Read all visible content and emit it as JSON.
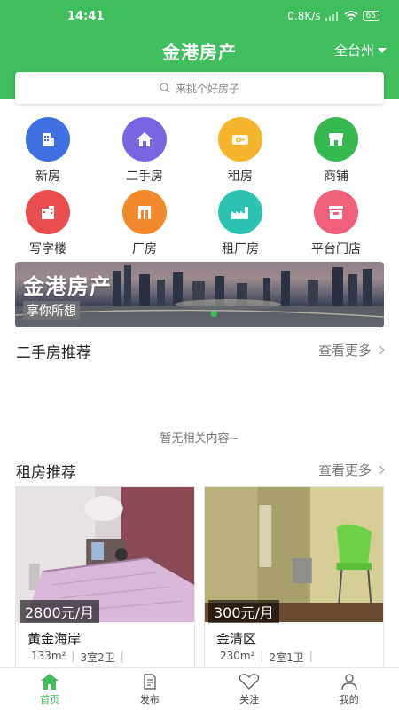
{
  "statusbar": {
    "time": "14:41",
    "network": "0.8K/s",
    "battery": "65"
  },
  "header": {
    "title": "金港房产",
    "city": "全台州"
  },
  "search": {
    "placeholder": "来挑个好房子"
  },
  "categories": [
    {
      "label": "新房",
      "icon": "building-icon",
      "color": "#3f6fe0"
    },
    {
      "label": "二手房",
      "icon": "house-icon",
      "color": "#7766e0"
    },
    {
      "label": "租房",
      "icon": "key-icon",
      "color": "#f5b52c"
    },
    {
      "label": "商铺",
      "icon": "shop-icon",
      "color": "#36b84f"
    },
    {
      "label": "写字楼",
      "icon": "office-icon",
      "color": "#ea4d4d"
    },
    {
      "label": "厂房",
      "icon": "factory-door-icon",
      "color": "#f08a2c"
    },
    {
      "label": "租厂房",
      "icon": "factory-icon",
      "color": "#2cc4b0"
    },
    {
      "label": "平台门店",
      "icon": "store-icon",
      "color": "#f0607a"
    }
  ],
  "banner": {
    "title": "金港房产",
    "subtitle": "享你所想"
  },
  "secondhand": {
    "title": "二手房推荐",
    "more": "查看更多",
    "empty": "暂无相关内容~"
  },
  "rental": {
    "title": "租房推荐",
    "more": "查看更多",
    "cards": [
      {
        "price": "2800元/月",
        "name": "黄金海岸",
        "area": "133m²",
        "rooms": "3室2卫"
      },
      {
        "price": "300元/月",
        "name": "金清区",
        "area": "230m²",
        "rooms": "2室1卫"
      }
    ]
  },
  "tabs": [
    {
      "label": "首页",
      "icon": "home-icon",
      "active": true
    },
    {
      "label": "发布",
      "icon": "document-icon",
      "active": false
    },
    {
      "label": "关注",
      "icon": "heart-icon",
      "active": false
    },
    {
      "label": "我的",
      "icon": "user-icon",
      "active": false
    }
  ],
  "colors": {
    "brand": "#3fbe5b"
  }
}
